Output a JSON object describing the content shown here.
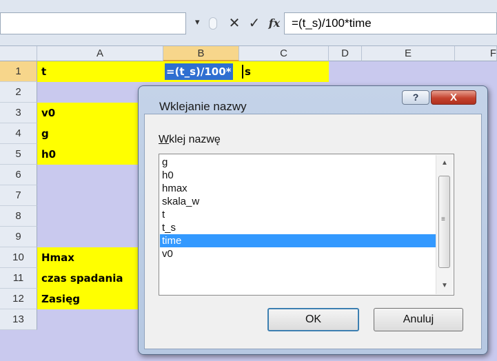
{
  "formula_bar": {
    "name_box_value": "",
    "dropdown_glyph": "▾",
    "cancel_glyph": "✕",
    "enter_glyph": "✓",
    "fx_label": "fx",
    "formula": "=(t_s)/100*time"
  },
  "sheet": {
    "column_headers": [
      "A",
      "B",
      "C",
      "D",
      "E",
      "F"
    ],
    "row_numbers": [
      "1",
      "2",
      "3",
      "4",
      "5",
      "6",
      "7",
      "8",
      "9",
      "10",
      "11",
      "12",
      "13"
    ],
    "cells_A": {
      "1": "t",
      "3": "v0",
      "4": "g",
      "5": "h0",
      "10": "Hmax",
      "11": "czas spadania",
      "12": "Zasięg"
    },
    "editing_cell_B1": {
      "selected_text": "=(t_s)/100*",
      "trailing_text": "s"
    },
    "colors": {
      "yellow_fill": "#ffff00",
      "lavender_fill": "#c9c9ee",
      "selection_blue": "#2f6fd1"
    }
  },
  "dialog": {
    "title": "Wklejanie nazwy",
    "help_glyph": "?",
    "close_glyph": "X",
    "list_label_underlined": "W",
    "list_label_rest": "klej nazwę",
    "names": [
      "g",
      "h0",
      "hmax",
      "skala_w",
      "t",
      "t_s",
      "time",
      "v0"
    ],
    "selected_name": "time",
    "ok_label": "OK",
    "cancel_label": "Anuluj",
    "scroll_up_glyph": "▲",
    "scroll_down_glyph": "▼",
    "thumb_grip_glyph": "≡",
    "selection_color": "#3399ff"
  }
}
